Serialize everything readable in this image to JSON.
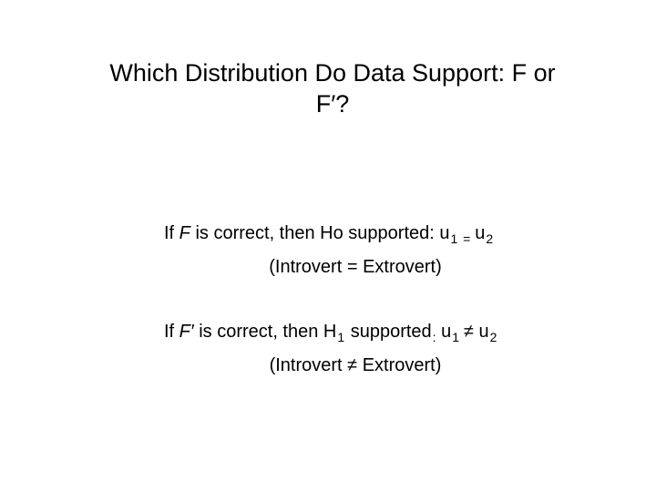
{
  "title": "Which Distribution Do Data Support: F or F′?",
  "body": {
    "line1": {
      "a": "If ",
      "b": "F",
      "c": " is correct, then Ho supported:  ",
      "u": "u",
      "s1": "1 ",
      "eq": "= ",
      "s2": "2"
    },
    "note1": "(Introvert = Extrovert)",
    "line2": {
      "a": "If ",
      "b": "F′",
      "c": " is correct, then H",
      "s1": "1",
      "d": " supported",
      "colon": ":",
      "sp": " ",
      "u": "u",
      "su1": "1 ",
      "neq": "≠ ",
      "su2": "2"
    },
    "note2": "(Introvert ≠ Extrovert)"
  }
}
